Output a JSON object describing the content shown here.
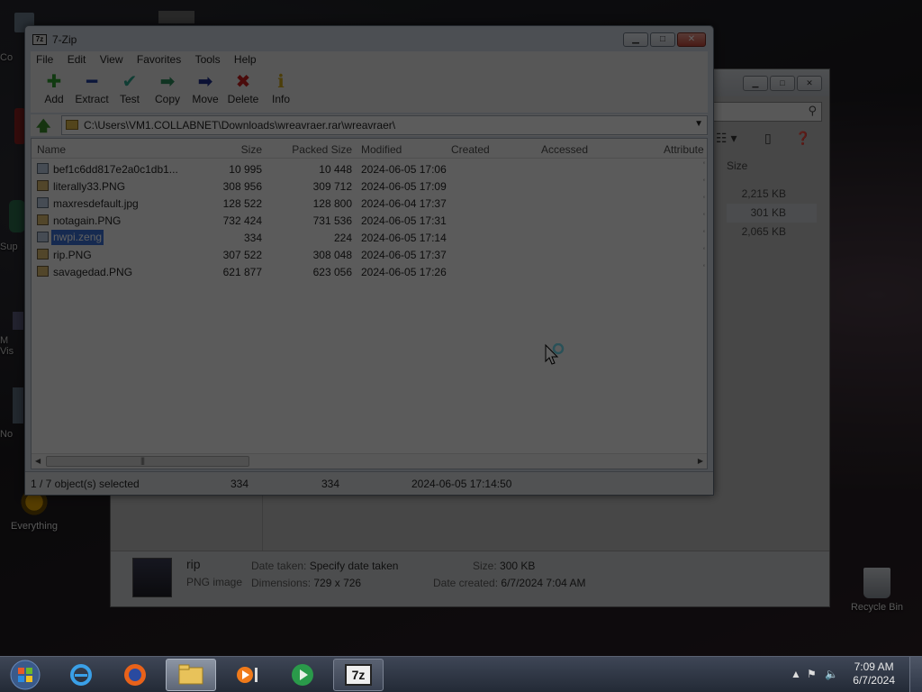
{
  "desktop": {
    "icons": [
      {
        "label": "Everything"
      },
      {
        "label": "Recycle Bin"
      }
    ],
    "edge_labels": [
      "Co",
      "Sup",
      "M\nVis",
      "No"
    ]
  },
  "explorer": {
    "size_header": "Size",
    "sizes": [
      "2,215 KB",
      "301 KB",
      "2,065 KB"
    ],
    "details": {
      "name": "rip",
      "type": "PNG image",
      "date_taken_label": "Date taken:",
      "date_taken_value": "Specify date taken",
      "dimensions_label": "Dimensions:",
      "dimensions_value": "729 x 726",
      "size_label": "Size:",
      "size_value": "300 KB",
      "date_created_label": "Date created:",
      "date_created_value": "6/7/2024 7:04 AM"
    }
  },
  "sevenzip": {
    "title": "7-Zip",
    "icon_text": "7z",
    "menu": [
      "File",
      "Edit",
      "View",
      "Favorites",
      "Tools",
      "Help"
    ],
    "toolbar": [
      {
        "label": "Add",
        "glyph": "✚",
        "color": "#2f9a2f"
      },
      {
        "label": "Extract",
        "glyph": "━",
        "color": "#1f3c9a"
      },
      {
        "label": "Test",
        "glyph": "✔",
        "color": "#2aa08a"
      },
      {
        "label": "Copy",
        "glyph": "➡",
        "color": "#2a8a5a"
      },
      {
        "label": "Move",
        "glyph": "➡",
        "color": "#1f2f8a"
      },
      {
        "label": "Delete",
        "glyph": "✖",
        "color": "#c21d1d"
      },
      {
        "label": "Info",
        "glyph": "ℹ",
        "color": "#c9a21a"
      }
    ],
    "path": "C:\\Users\\VM1.COLLABNET\\Downloads\\wreavraer.rar\\wreavraer\\",
    "columns": [
      "Name",
      "Size",
      "Packed Size",
      "Modified",
      "Created",
      "Accessed",
      "Attribute"
    ],
    "files": [
      {
        "name": "bef1c6dd817e2a0c1db1...",
        "size": "10 995",
        "packed": "10 448",
        "modified": "2024-06-05 17:06",
        "icon": "gen"
      },
      {
        "name": "literally33.PNG",
        "size": "308 956",
        "packed": "309 712",
        "modified": "2024-06-05 17:09",
        "icon": "img"
      },
      {
        "name": "maxresdefault.jpg",
        "size": "128 522",
        "packed": "128 800",
        "modified": "2024-06-04 17:37",
        "icon": "gen"
      },
      {
        "name": "notagain.PNG",
        "size": "732 424",
        "packed": "731 536",
        "modified": "2024-06-05 17:31",
        "icon": "img"
      },
      {
        "name": "nwpi.zeng",
        "size": "334",
        "packed": "224",
        "modified": "2024-06-05 17:14",
        "icon": "gen",
        "selected": true
      },
      {
        "name": "rip.PNG",
        "size": "307 522",
        "packed": "308 048",
        "modified": "2024-06-05 17:37",
        "icon": "img"
      },
      {
        "name": "savagedad.PNG",
        "size": "621 877",
        "packed": "623 056",
        "modified": "2024-06-05 17:26",
        "icon": "img"
      }
    ],
    "status": {
      "selection": "1 / 7 object(s) selected",
      "size": "334",
      "packed": "334",
      "modified": "2024-06-05 17:14:50"
    }
  },
  "taskbar": {
    "clock_time": "7:09 AM",
    "clock_date": "6/7/2024",
    "items": [
      "start-orb",
      "internet-explorer",
      "firefox",
      "file-explorer",
      "media-player",
      "media-center",
      "7-zip"
    ]
  }
}
